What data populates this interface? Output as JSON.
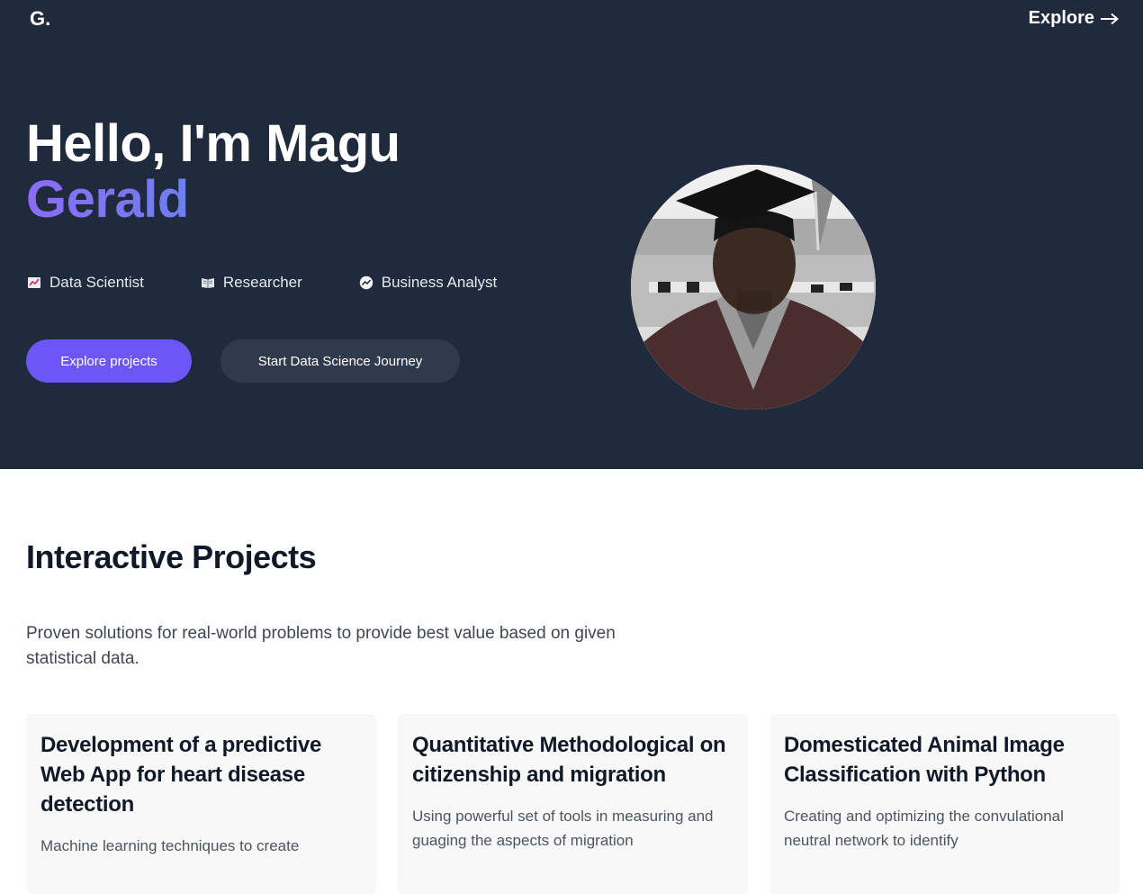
{
  "header": {
    "logo": "G.",
    "explore_label": "Explore",
    "explore_arrow": "arrow-right-icon"
  },
  "hero": {
    "greeting": "Hello, I'm Magu",
    "name": "Gerald",
    "name_gradient": [
      "#8b6cf6",
      "#6e7ff0"
    ],
    "roles": [
      {
        "label": "Data Scientist",
        "icon": "chart-increasing-icon"
      },
      {
        "label": "Researcher",
        "icon": "open-book-icon"
      },
      {
        "label": "Business Analyst",
        "icon": "analytics-icon"
      }
    ],
    "primary_button": "Explore projects",
    "secondary_button": "Start Data Science Journey",
    "avatar_icon": "profile-photo-graduate"
  },
  "projects": {
    "title": "Interactive Projects",
    "description": "Proven solutions for real-world problems to provide best value based on given statistical data.",
    "cards": [
      {
        "title": "Development of a predictive Web App for heart disease detection",
        "description": "Machine learning techniques to create"
      },
      {
        "title": "Quantitative Methodological on citizenship and migration",
        "description": "Using powerful set of tools in measuring and guaging the aspects of migration"
      },
      {
        "title": "Domesticated Animal Image Classification with Python",
        "description": "Creating and optimizing the convulational neutral network to identify"
      }
    ]
  },
  "colors": {
    "hero_bg": "#1f2a3c",
    "accent": "#6c56f5",
    "secondary_button": "#2f3a4c",
    "card_bg": "#f8f8f8"
  }
}
